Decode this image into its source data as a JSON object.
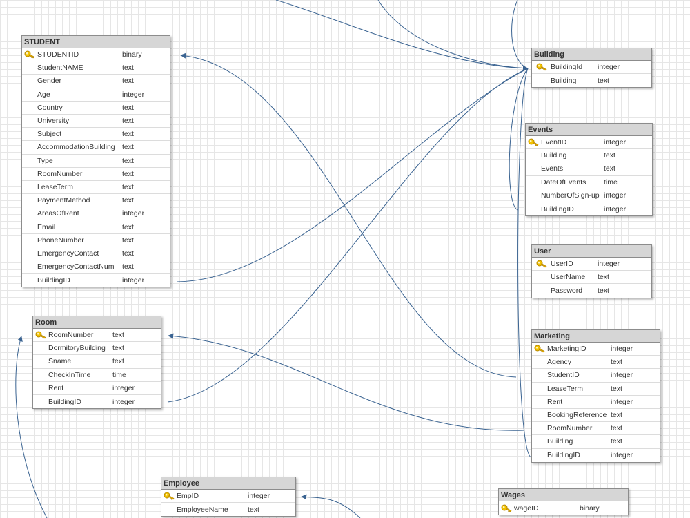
{
  "tables": [
    {
      "id": "student",
      "title": "STUDENT",
      "fields": [
        {
          "name": "STUDENTID",
          "type": "binary",
          "pk": true
        },
        {
          "name": "StudentNAME",
          "type": "text"
        },
        {
          "name": "Gender",
          "type": "text"
        },
        {
          "name": "Age",
          "type": "integer"
        },
        {
          "name": "Country",
          "type": "text"
        },
        {
          "name": "University",
          "type": "text"
        },
        {
          "name": "Subject",
          "type": "text"
        },
        {
          "name": "AccommodationBuilding",
          "type": "text"
        },
        {
          "name": "Type",
          "type": "text"
        },
        {
          "name": "RoomNumber",
          "type": "text"
        },
        {
          "name": "LeaseTerm",
          "type": "text"
        },
        {
          "name": "PaymentMethod",
          "type": "text"
        },
        {
          "name": "AreasOfRent",
          "type": "integer"
        },
        {
          "name": "Email",
          "type": "text"
        },
        {
          "name": "PhoneNumber",
          "type": "text"
        },
        {
          "name": "EmergencyContact",
          "type": "text"
        },
        {
          "name": "EmergencyContactNum",
          "type": "text"
        },
        {
          "name": "BuildingID",
          "type": "integer"
        }
      ]
    },
    {
      "id": "room",
      "title": "Room",
      "fields": [
        {
          "name": "RoomNumber",
          "type": "text",
          "pk": true
        },
        {
          "name": "DormitoryBuilding",
          "type": "text"
        },
        {
          "name": "Sname",
          "type": "text"
        },
        {
          "name": "CheckInTime",
          "type": "time"
        },
        {
          "name": "Rent",
          "type": "integer"
        },
        {
          "name": "BuildingID",
          "type": "integer"
        }
      ]
    },
    {
      "id": "employee",
      "title": "Employee",
      "fields": [
        {
          "name": "EmpID",
          "type": "integer",
          "pk": true
        },
        {
          "name": "EmployeeName",
          "type": "text"
        }
      ]
    },
    {
      "id": "building",
      "title": "Building",
      "fields": [
        {
          "name": "BuildingId",
          "type": "integer",
          "pk": true
        },
        {
          "name": "Building",
          "type": "text"
        }
      ]
    },
    {
      "id": "events",
      "title": "Events",
      "fields": [
        {
          "name": "EventID",
          "type": "integer",
          "pk": true
        },
        {
          "name": "Building",
          "type": "text"
        },
        {
          "name": "Events",
          "type": "text"
        },
        {
          "name": "DateOfEvents",
          "type": "time"
        },
        {
          "name": "NumberOfSign-up",
          "type": "integer"
        },
        {
          "name": "BuildingID",
          "type": "integer"
        }
      ]
    },
    {
      "id": "user",
      "title": "User",
      "fields": [
        {
          "name": "UserID",
          "type": "integer",
          "pk": true
        },
        {
          "name": "UserName",
          "type": "text"
        },
        {
          "name": "Password",
          "type": "text"
        }
      ]
    },
    {
      "id": "marketing",
      "title": "Marketing",
      "fields": [
        {
          "name": "MarketingID",
          "type": "integer",
          "pk": true
        },
        {
          "name": "Agency",
          "type": "text"
        },
        {
          "name": "StudentID",
          "type": "integer"
        },
        {
          "name": "LeaseTerm",
          "type": "text"
        },
        {
          "name": "Rent",
          "type": "integer"
        },
        {
          "name": "BookingReference",
          "type": "text"
        },
        {
          "name": "RoomNumber",
          "type": "text"
        },
        {
          "name": "Building",
          "type": "text"
        },
        {
          "name": "BuildingID",
          "type": "integer"
        }
      ]
    },
    {
      "id": "wages",
      "title": "Wages",
      "fields": [
        {
          "name": "wageID",
          "type": "binary",
          "pk": true
        }
      ]
    }
  ],
  "colors": {
    "header": "#d6d6d6",
    "border": "#8c8c8c",
    "edge": "#3a6391",
    "key": "#e8b400"
  },
  "icons": {
    "primary_key": "key-icon"
  }
}
